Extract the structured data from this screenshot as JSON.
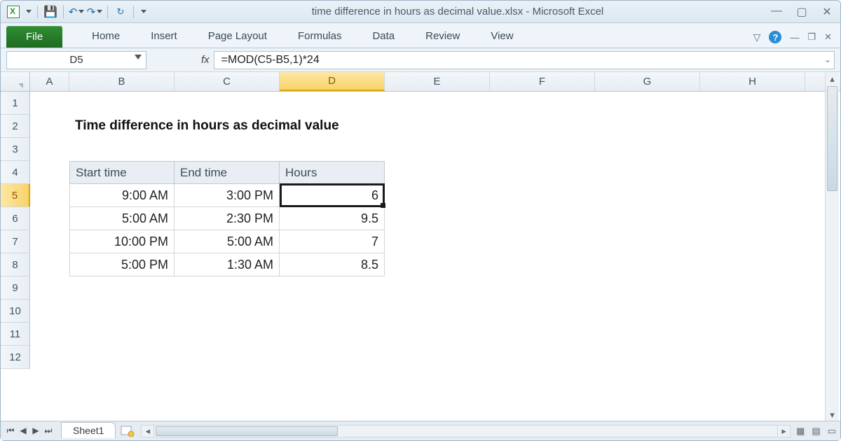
{
  "window": {
    "title": "time difference in hours as decimal value.xlsx  -  Microsoft Excel"
  },
  "ribbon": {
    "file": "File",
    "tabs": [
      "Home",
      "Insert",
      "Page Layout",
      "Formulas",
      "Data",
      "Review",
      "View"
    ]
  },
  "namebox": "D5",
  "formula": "=MOD(C5-B5,1)*24",
  "columns": [
    "A",
    "B",
    "C",
    "D",
    "E",
    "F",
    "G",
    "H"
  ],
  "rows_visible": [
    "1",
    "2",
    "3",
    "4",
    "5",
    "6",
    "7",
    "8",
    "9",
    "10",
    "11",
    "12"
  ],
  "active": {
    "col": "D",
    "row": "5"
  },
  "sheet": {
    "heading": "Time difference in hours as decimal value",
    "table": {
      "headers": [
        "Start time",
        "End time",
        "Hours"
      ],
      "rows": [
        {
          "start": "9:00 AM",
          "end": "3:00 PM",
          "hours": "6"
        },
        {
          "start": "5:00 AM",
          "end": "2:30 PM",
          "hours": "9.5"
        },
        {
          "start": "10:00 PM",
          "end": "5:00 AM",
          "hours": "7"
        },
        {
          "start": "5:00 PM",
          "end": "1:30 AM",
          "hours": "8.5"
        }
      ]
    }
  },
  "sheet_tab": "Sheet1"
}
